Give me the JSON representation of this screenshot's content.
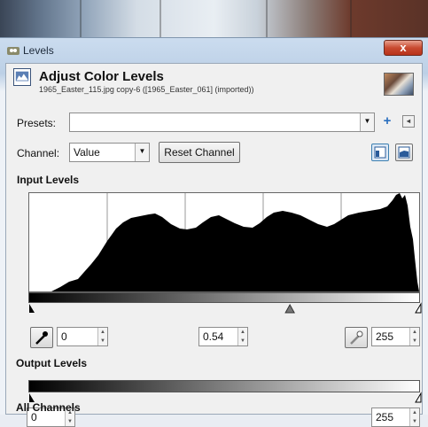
{
  "window": {
    "title": "Levels",
    "close_label": "x"
  },
  "header": {
    "title": "Adjust Color Levels",
    "subtitle": "1965_Easter_115.jpg copy-6 ([1965_Easter_061] (imported))"
  },
  "presets": {
    "label": "Presets:",
    "value": ""
  },
  "channel": {
    "label": "Channel:",
    "value": "Value",
    "reset_label": "Reset Channel"
  },
  "input_levels": {
    "title": "Input Levels",
    "low": "0",
    "gamma": "0.54",
    "high": "255",
    "gamma_marker_fraction": 0.67
  },
  "output_levels": {
    "title": "Output Levels",
    "low": "0",
    "high": "255"
  },
  "all_channels": {
    "title": "All Channels"
  },
  "colors": {
    "close": "#c84a30",
    "histogram": "#000000"
  }
}
